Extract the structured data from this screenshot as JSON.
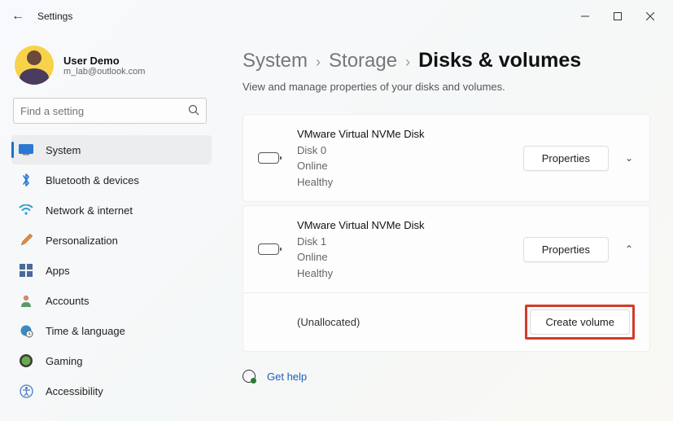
{
  "window": {
    "title": "Settings"
  },
  "user": {
    "name": "User Demo",
    "email": "m_lab@outlook.com"
  },
  "search": {
    "placeholder": "Find a setting"
  },
  "nav": {
    "items": [
      {
        "label": "System"
      },
      {
        "label": "Bluetooth & devices"
      },
      {
        "label": "Network & internet"
      },
      {
        "label": "Personalization"
      },
      {
        "label": "Apps"
      },
      {
        "label": "Accounts"
      },
      {
        "label": "Time & language"
      },
      {
        "label": "Gaming"
      },
      {
        "label": "Accessibility"
      }
    ]
  },
  "breadcrumb": {
    "level1": "System",
    "level2": "Storage",
    "current": "Disks & volumes"
  },
  "subtitle": "View and manage properties of your disks and volumes.",
  "disks": [
    {
      "name": "VMware Virtual NVMe Disk",
      "id": "Disk 0",
      "status": "Online",
      "health": "Healthy",
      "properties_label": "Properties"
    },
    {
      "name": "VMware Virtual NVMe Disk",
      "id": "Disk 1",
      "status": "Online",
      "health": "Healthy",
      "properties_label": "Properties",
      "volumes": [
        {
          "label": "(Unallocated)",
          "action": "Create volume"
        }
      ]
    }
  ],
  "help": {
    "label": "Get help"
  }
}
